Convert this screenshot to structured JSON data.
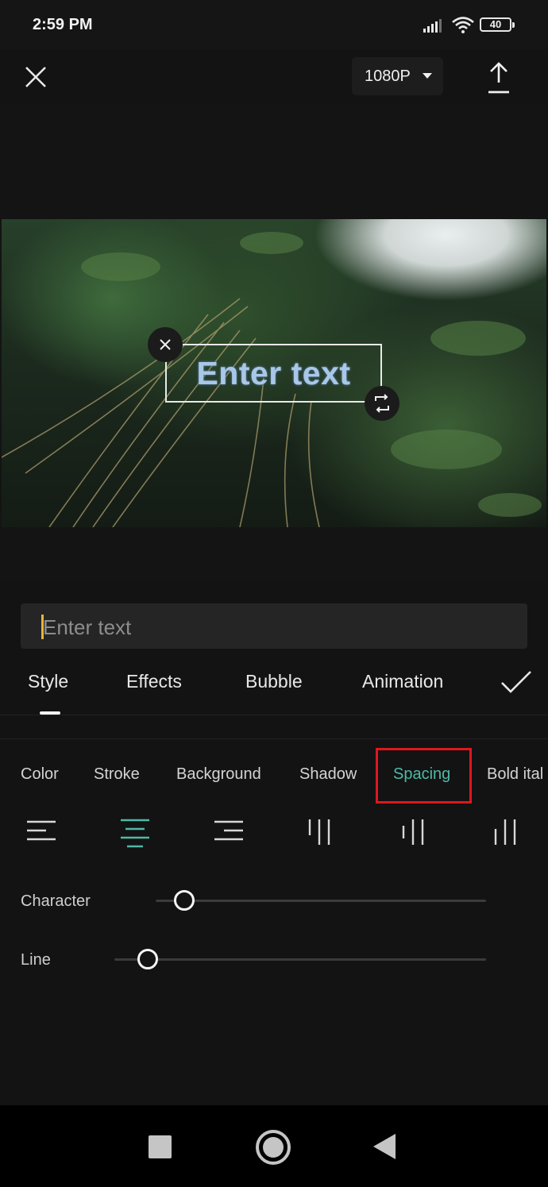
{
  "status_bar": {
    "time": "2:59 PM",
    "battery": "40",
    "icons": [
      "signal-icon",
      "wifi-icon",
      "battery-icon"
    ]
  },
  "top_bar": {
    "resolution": "1080P",
    "icons": [
      "close-icon",
      "chevron-down-icon",
      "export-icon"
    ]
  },
  "preview": {
    "overlay_text": "Enter text",
    "icons": [
      "close-icon",
      "rotate-resize-icon"
    ]
  },
  "editor": {
    "input_placeholder": "Enter text",
    "tabs": [
      {
        "label": "Style",
        "active": true
      },
      {
        "label": "Effects",
        "active": false
      },
      {
        "label": "Bubble",
        "active": false
      },
      {
        "label": "Animation",
        "active": false
      }
    ],
    "subtabs": [
      {
        "label": "Color",
        "active": false
      },
      {
        "label": "Stroke",
        "active": false
      },
      {
        "label": "Background",
        "active": false
      },
      {
        "label": "Shadow",
        "active": false
      },
      {
        "label": "Spacing",
        "active": true
      },
      {
        "label": "Bold ital",
        "active": false
      }
    ],
    "alignment_options": [
      {
        "name": "align-left-icon",
        "selected": false
      },
      {
        "name": "align-center-icon",
        "selected": true
      },
      {
        "name": "align-right-icon",
        "selected": false
      },
      {
        "name": "vertical-align-top-icon",
        "selected": false
      },
      {
        "name": "vertical-align-center-icon",
        "selected": false
      },
      {
        "name": "vertical-align-bottom-icon",
        "selected": false
      }
    ],
    "sliders": {
      "character": {
        "label": "Character",
        "value_fraction": 0.09
      },
      "line": {
        "label": "Line",
        "value_fraction": 0.09
      }
    }
  },
  "colors": {
    "accent": "#4fb9a7",
    "highlight_box": "#e0161e",
    "cursor": "#e7b43a",
    "background": "#131313"
  },
  "nav_bar": {
    "icons": [
      "recents-icon",
      "home-icon",
      "back-icon"
    ]
  }
}
